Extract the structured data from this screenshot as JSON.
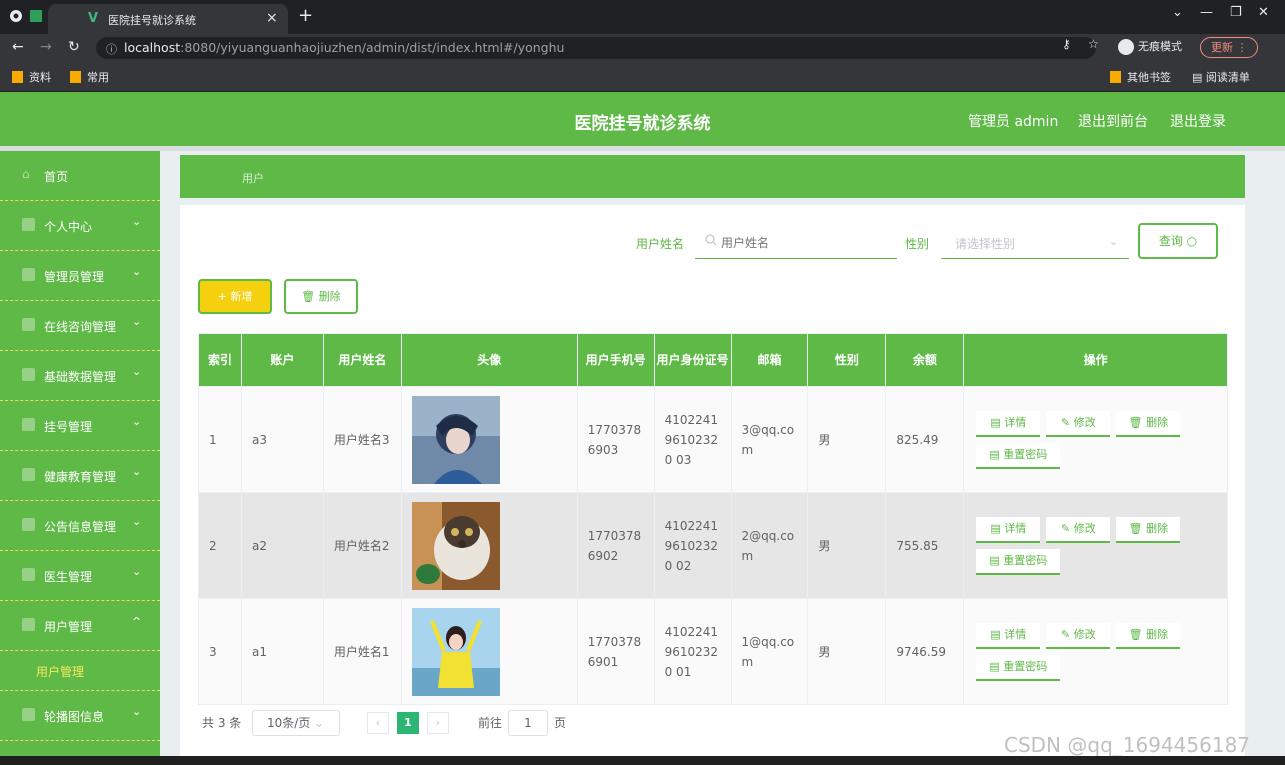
{
  "browser": {
    "tab_title": "医院挂号就诊系统",
    "tab_close": "×",
    "new_tab": "+",
    "url_host": "localhost",
    "url_rest": ":8080/yiyuanguanhaojiuzhen/admin/dist/index.html#/yonghu",
    "incognito_label": "无痕模式",
    "update_label": "更新",
    "bookmarks": [
      "资料",
      "常用"
    ],
    "other_bookmarks": "其他书签",
    "reading_list": "阅读清单"
  },
  "header": {
    "title": "医院挂号就诊系统",
    "admin_label": "管理员 admin",
    "exit_front": "退出到前台",
    "logout": "退出登录"
  },
  "sidebar": {
    "items": [
      {
        "label": "首页",
        "chevron": ""
      },
      {
        "label": "个人中心",
        "chevron": "⌄"
      },
      {
        "label": "管理员管理",
        "chevron": "⌄"
      },
      {
        "label": "在线咨询管理",
        "chevron": "⌄"
      },
      {
        "label": "基础数据管理",
        "chevron": "⌄"
      },
      {
        "label": "挂号管理",
        "chevron": "⌄"
      },
      {
        "label": "健康教育管理",
        "chevron": "⌄"
      },
      {
        "label": "公告信息管理",
        "chevron": "⌄"
      },
      {
        "label": "医生管理",
        "chevron": "⌄"
      },
      {
        "label": "用户管理",
        "chevron": "^"
      },
      {
        "label": "轮播图信息",
        "chevron": "⌄"
      }
    ],
    "sub_item": "用户管理"
  },
  "breadcrumb": "用户",
  "search": {
    "name_label": "用户姓名",
    "name_placeholder": "用户姓名",
    "gender_label": "性别",
    "gender_placeholder": "请选择性别",
    "query_label": "查询"
  },
  "actions": {
    "add_label": "+ 新增",
    "delete_label": "删除"
  },
  "table": {
    "headers": [
      "索引",
      "账户",
      "用户姓名",
      "头像",
      "用户手机号",
      "用户身份证号",
      "邮箱",
      "性别",
      "余额",
      "操作"
    ],
    "rows": [
      {
        "index": "1",
        "account": "a3",
        "name": "用户姓名3",
        "phone": "17703786903",
        "idcard": "410224196102320 03",
        "email": "3@qq.com",
        "gender": "男",
        "balance": "825.49"
      },
      {
        "index": "2",
        "account": "a2",
        "name": "用户姓名2",
        "phone": "17703786902",
        "idcard": "410224196102320 02",
        "email": "2@qq.com",
        "gender": "男",
        "balance": "755.85"
      },
      {
        "index": "3",
        "account": "a1",
        "name": "用户姓名1",
        "phone": "17703786901",
        "idcard": "410224196102320 01",
        "email": "1@qq.com",
        "gender": "男",
        "balance": "9746.59"
      }
    ],
    "ops": {
      "detail": "详情",
      "edit": "修改",
      "delete": "删除",
      "reset": "重置密码"
    }
  },
  "pagination": {
    "total": "共 3 条",
    "page_size": "10条/页",
    "current": "1",
    "goto_prefix": "前往",
    "goto_value": "1",
    "goto_suffix": "页"
  },
  "watermark": "CSDN @qq_1694456187",
  "colors": {
    "primary": "#5fb947",
    "accent": "#f4d00f",
    "pager": "#2bb673"
  }
}
